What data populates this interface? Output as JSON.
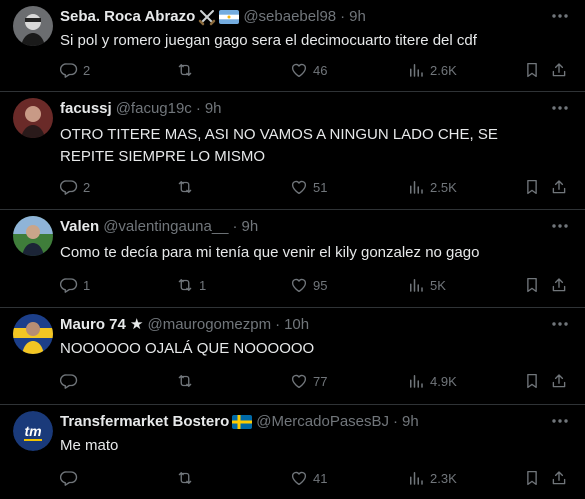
{
  "tweets": [
    {
      "name": "Seba. Roca Abrazo",
      "badges": [
        "crossed-swords-emoji",
        "argentina-flag-emoji"
      ],
      "handle": "@sebaebel98",
      "time": "9h",
      "text": "Si pol y romero juegan gago sera el decimocuarto titere del cdf",
      "replies": "2",
      "reposts": "",
      "likes": "46",
      "views": "2.6K"
    },
    {
      "name": "facussj",
      "badges": [],
      "handle": "@facug19c",
      "time": "9h",
      "text": "OTRO TITERE MAS, ASI NO VAMOS A NINGUN LADO CHE, SE REPITE SIEMPRE LO MISMO",
      "replies": "2",
      "reposts": "",
      "likes": "51",
      "views": "2.5K"
    },
    {
      "name": "Valen",
      "badges": [],
      "handle": "@valentingauna__",
      "time": "9h",
      "text": "Como te decía para mi tenía que venir el kily gonzalez no gago",
      "replies": "1",
      "reposts": "1",
      "likes": "95",
      "views": "5K"
    },
    {
      "name": "Mauro 74 ★",
      "badges": [],
      "handle": "@maurogomezpm",
      "time": "10h",
      "text": "NOOOOOO OJALÁ QUE NOOOOOO",
      "replies": "",
      "reposts": "",
      "likes": "77",
      "views": "4.9K"
    },
    {
      "name": "Transfermarket Bostero",
      "badges": [
        "sweden-flag-emoji"
      ],
      "handle": "@MercadoPasesBJ",
      "time": "9h",
      "text": "Me mato",
      "replies": "",
      "reposts": "",
      "likes": "41",
      "views": "2.3K"
    }
  ],
  "separator": "·",
  "colors": {
    "background": "#000000",
    "text": "#e7e9ea",
    "muted": "#71767b",
    "border": "#2f3336"
  },
  "icons": [
    "reply-icon",
    "repost-icon",
    "like-icon",
    "views-icon",
    "bookmark-icon",
    "share-icon",
    "more-icon"
  ]
}
